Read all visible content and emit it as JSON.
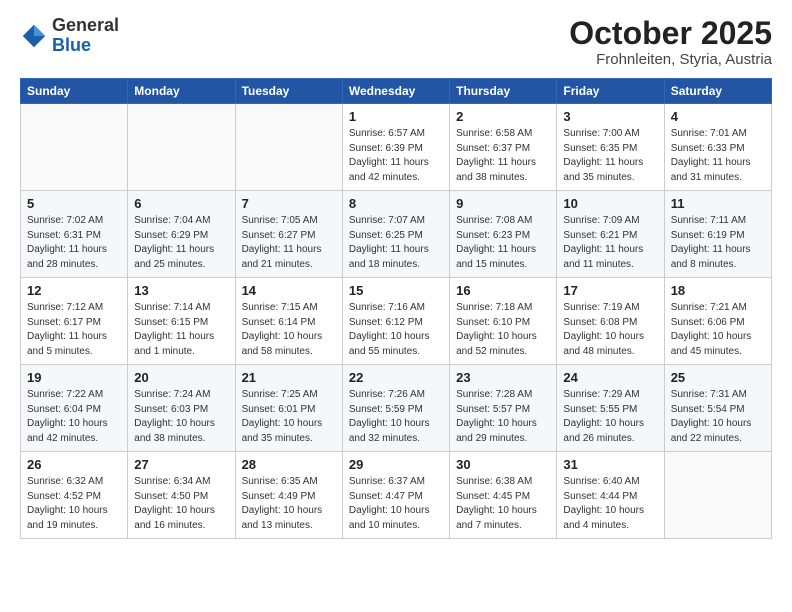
{
  "header": {
    "logo_general": "General",
    "logo_blue": "Blue",
    "title": "October 2025",
    "subtitle": "Frohnleiten, Styria, Austria"
  },
  "days_of_week": [
    "Sunday",
    "Monday",
    "Tuesday",
    "Wednesday",
    "Thursday",
    "Friday",
    "Saturday"
  ],
  "weeks": [
    [
      {
        "date": "",
        "info": ""
      },
      {
        "date": "",
        "info": ""
      },
      {
        "date": "",
        "info": ""
      },
      {
        "date": "1",
        "info": "Sunrise: 6:57 AM\nSunset: 6:39 PM\nDaylight: 11 hours and 42 minutes."
      },
      {
        "date": "2",
        "info": "Sunrise: 6:58 AM\nSunset: 6:37 PM\nDaylight: 11 hours and 38 minutes."
      },
      {
        "date": "3",
        "info": "Sunrise: 7:00 AM\nSunset: 6:35 PM\nDaylight: 11 hours and 35 minutes."
      },
      {
        "date": "4",
        "info": "Sunrise: 7:01 AM\nSunset: 6:33 PM\nDaylight: 11 hours and 31 minutes."
      }
    ],
    [
      {
        "date": "5",
        "info": "Sunrise: 7:02 AM\nSunset: 6:31 PM\nDaylight: 11 hours and 28 minutes."
      },
      {
        "date": "6",
        "info": "Sunrise: 7:04 AM\nSunset: 6:29 PM\nDaylight: 11 hours and 25 minutes."
      },
      {
        "date": "7",
        "info": "Sunrise: 7:05 AM\nSunset: 6:27 PM\nDaylight: 11 hours and 21 minutes."
      },
      {
        "date": "8",
        "info": "Sunrise: 7:07 AM\nSunset: 6:25 PM\nDaylight: 11 hours and 18 minutes."
      },
      {
        "date": "9",
        "info": "Sunrise: 7:08 AM\nSunset: 6:23 PM\nDaylight: 11 hours and 15 minutes."
      },
      {
        "date": "10",
        "info": "Sunrise: 7:09 AM\nSunset: 6:21 PM\nDaylight: 11 hours and 11 minutes."
      },
      {
        "date": "11",
        "info": "Sunrise: 7:11 AM\nSunset: 6:19 PM\nDaylight: 11 hours and 8 minutes."
      }
    ],
    [
      {
        "date": "12",
        "info": "Sunrise: 7:12 AM\nSunset: 6:17 PM\nDaylight: 11 hours and 5 minutes."
      },
      {
        "date": "13",
        "info": "Sunrise: 7:14 AM\nSunset: 6:15 PM\nDaylight: 11 hours and 1 minute."
      },
      {
        "date": "14",
        "info": "Sunrise: 7:15 AM\nSunset: 6:14 PM\nDaylight: 10 hours and 58 minutes."
      },
      {
        "date": "15",
        "info": "Sunrise: 7:16 AM\nSunset: 6:12 PM\nDaylight: 10 hours and 55 minutes."
      },
      {
        "date": "16",
        "info": "Sunrise: 7:18 AM\nSunset: 6:10 PM\nDaylight: 10 hours and 52 minutes."
      },
      {
        "date": "17",
        "info": "Sunrise: 7:19 AM\nSunset: 6:08 PM\nDaylight: 10 hours and 48 minutes."
      },
      {
        "date": "18",
        "info": "Sunrise: 7:21 AM\nSunset: 6:06 PM\nDaylight: 10 hours and 45 minutes."
      }
    ],
    [
      {
        "date": "19",
        "info": "Sunrise: 7:22 AM\nSunset: 6:04 PM\nDaylight: 10 hours and 42 minutes."
      },
      {
        "date": "20",
        "info": "Sunrise: 7:24 AM\nSunset: 6:03 PM\nDaylight: 10 hours and 38 minutes."
      },
      {
        "date": "21",
        "info": "Sunrise: 7:25 AM\nSunset: 6:01 PM\nDaylight: 10 hours and 35 minutes."
      },
      {
        "date": "22",
        "info": "Sunrise: 7:26 AM\nSunset: 5:59 PM\nDaylight: 10 hours and 32 minutes."
      },
      {
        "date": "23",
        "info": "Sunrise: 7:28 AM\nSunset: 5:57 PM\nDaylight: 10 hours and 29 minutes."
      },
      {
        "date": "24",
        "info": "Sunrise: 7:29 AM\nSunset: 5:55 PM\nDaylight: 10 hours and 26 minutes."
      },
      {
        "date": "25",
        "info": "Sunrise: 7:31 AM\nSunset: 5:54 PM\nDaylight: 10 hours and 22 minutes."
      }
    ],
    [
      {
        "date": "26",
        "info": "Sunrise: 6:32 AM\nSunset: 4:52 PM\nDaylight: 10 hours and 19 minutes."
      },
      {
        "date": "27",
        "info": "Sunrise: 6:34 AM\nSunset: 4:50 PM\nDaylight: 10 hours and 16 minutes."
      },
      {
        "date": "28",
        "info": "Sunrise: 6:35 AM\nSunset: 4:49 PM\nDaylight: 10 hours and 13 minutes."
      },
      {
        "date": "29",
        "info": "Sunrise: 6:37 AM\nSunset: 4:47 PM\nDaylight: 10 hours and 10 minutes."
      },
      {
        "date": "30",
        "info": "Sunrise: 6:38 AM\nSunset: 4:45 PM\nDaylight: 10 hours and 7 minutes."
      },
      {
        "date": "31",
        "info": "Sunrise: 6:40 AM\nSunset: 4:44 PM\nDaylight: 10 hours and 4 minutes."
      },
      {
        "date": "",
        "info": ""
      }
    ]
  ]
}
